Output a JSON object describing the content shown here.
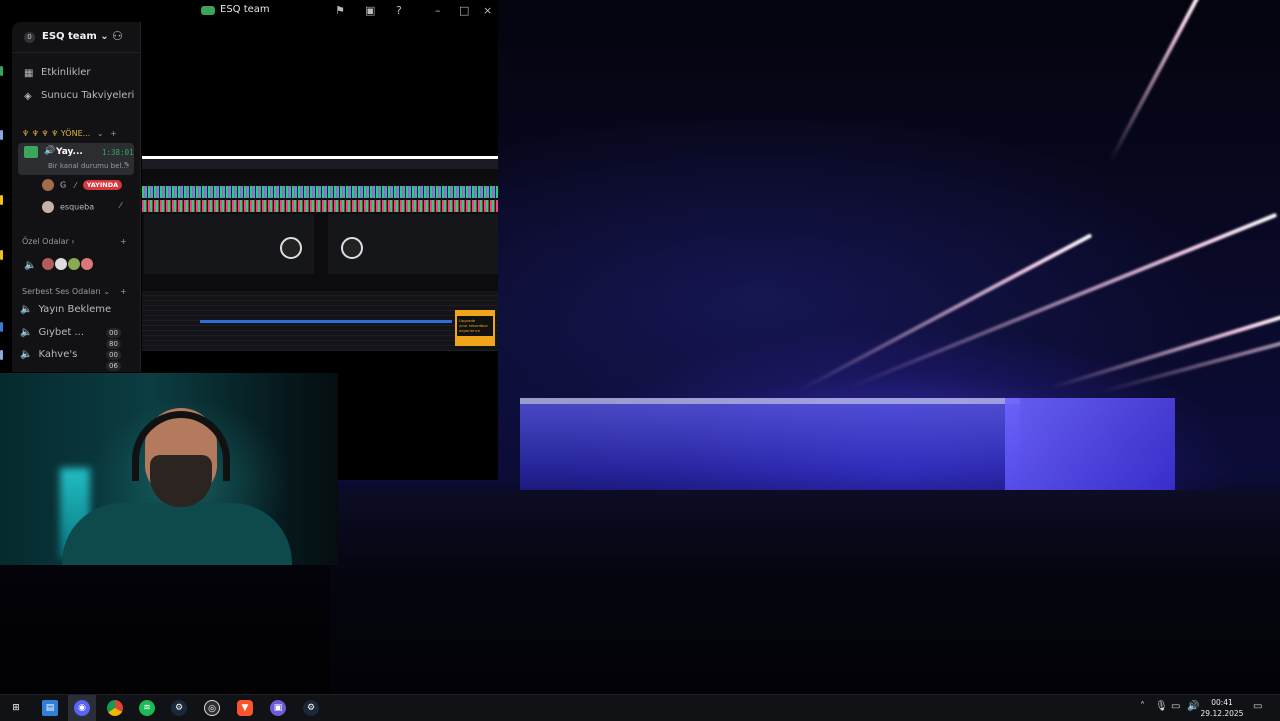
{
  "window": {
    "title": "ESQ team"
  },
  "guild": {
    "badge": "0",
    "name": "ESQ team",
    "name_suffix": "⌄"
  },
  "nav": {
    "events": "Etkinlikler",
    "boosts": "Sunucu Takviyeleri"
  },
  "categories": {
    "management": "♆ ♆ ♆ ♆ YÖNE...",
    "private": "Özel Odalar",
    "free_voice": "Serbest Ses Odaları"
  },
  "active_channel": {
    "name": "Yay...",
    "timer": "1:38:01",
    "status": "Bir kanal durumu bel..."
  },
  "voice_users": [
    {
      "name": "G",
      "badge": "YAYINDA"
    },
    {
      "name": "esqueba",
      "badge": ""
    }
  ],
  "channels": [
    {
      "name": "Yayın Bekleme",
      "count_a": "",
      "count_b": ""
    },
    {
      "name": "Gıybet ...",
      "count_a": "00",
      "count_b": "80"
    },
    {
      "name": "Kahve's",
      "count_a": "00",
      "count_b": "06"
    }
  ],
  "dj_software": {
    "promo_text_1": "Upgrade",
    "promo_text_2": "your rekordbox",
    "promo_text_3": "experience"
  },
  "taskbar": {
    "time": "00:41",
    "date": "29.12.2025"
  },
  "colors": {
    "accent_green": "#3ba55c",
    "live_red": "#da373c",
    "promo_orange": "#f0a41a"
  }
}
